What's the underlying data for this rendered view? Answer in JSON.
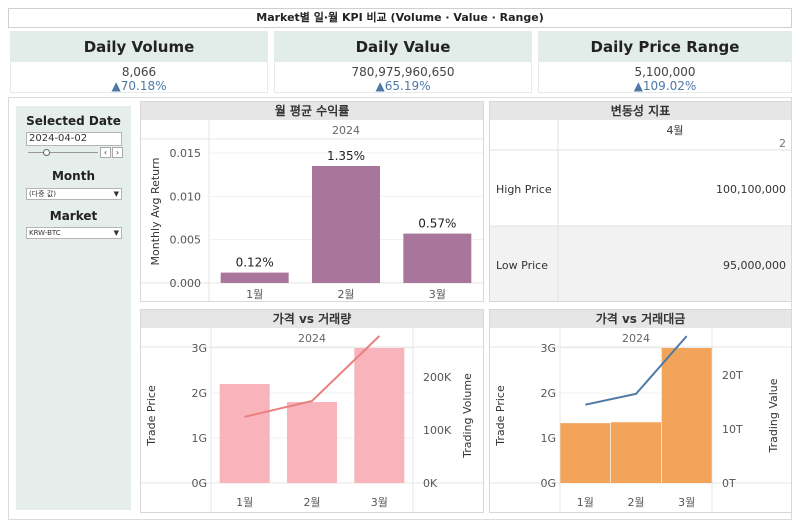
{
  "title": "Market별 일·월 KPI 비교 (Volume · Value · Range)",
  "kpis": [
    {
      "label": "Daily Volume",
      "value": "8,066",
      "change": "▲70.18%"
    },
    {
      "label": "Daily Value",
      "value": "780,975,960,650",
      "change": "▲65.19%"
    },
    {
      "label": "Daily Price Range",
      "value": "5,100,000",
      "change": "▲109.02%"
    }
  ],
  "filters": {
    "selected_date_label": "Selected Date",
    "selected_date_value": "2024-04-02",
    "month_label": "Month",
    "month_value": "(다중 값)",
    "market_label": "Market",
    "market_value": "KRW-BTC"
  },
  "colors": {
    "accent": "#4e79a7",
    "kpi_header": "#e2ece8",
    "sidebar": "#e6eeec",
    "bar_purple": "#a8769b",
    "bar_pink": "#f8b3bb",
    "bar_orange": "#f1a45a",
    "line_red": "#e88080",
    "line_blue": "#4e79a7"
  },
  "panels": {
    "monthly_return": {
      "title": "월 평균 수익률",
      "year": "2024",
      "chart_data": {
        "type": "bar",
        "categories": [
          "1월",
          "2월",
          "3월"
        ],
        "values": [
          0.0012,
          0.0135,
          0.0057
        ],
        "data_labels": [
          "0.12%",
          "1.35%",
          "0.57%"
        ],
        "ylabel": "Monthly Avg Return",
        "yticks": [
          "0.000",
          "0.005",
          "0.010",
          "0.015"
        ],
        "ylim": [
          0,
          0.0165
        ]
      }
    },
    "volatility": {
      "title": "변동성 지표",
      "month": "4월",
      "day": "2",
      "rows": [
        {
          "label": "High Price",
          "value": "100,100,000"
        },
        {
          "label": "Low Price",
          "value": "95,000,000"
        }
      ]
    },
    "price_vs_volume": {
      "title": "가격 vs 거래량",
      "year": "2024",
      "chart_data": {
        "type": "bar",
        "categories": [
          "1월",
          "2월",
          "3월"
        ],
        "bar_values": [
          2.2,
          1.8,
          3.0
        ],
        "line_values": [
          125,
          155,
          305
        ],
        "ylabel": "Trade Price",
        "y2label": "Trading Volume",
        "yticks": [
          "0G",
          "1G",
          "2G",
          "3G"
        ],
        "y2ticks": [
          "0K",
          "100K",
          "200K"
        ],
        "ylim": [
          0,
          3.0
        ],
        "y2lim": [
          0,
          255
        ]
      }
    },
    "price_vs_value": {
      "title": "가격 vs 거래대금",
      "year": "2024",
      "chart_data": {
        "type": "bar",
        "categories": [
          "1월",
          "2월",
          "3월"
        ],
        "bar_values": [
          1.33,
          1.35,
          3.0
        ],
        "line_values": [
          14.5,
          16.5,
          27.2
        ],
        "ylabel": "Trade Price",
        "y2label": "Trading Value",
        "yticks": [
          "0G",
          "1G",
          "2G",
          "3G"
        ],
        "y2ticks": [
          "0T",
          "10T",
          "20T"
        ],
        "ylim": [
          0,
          3.0
        ],
        "y2lim": [
          0,
          25
        ]
      }
    }
  }
}
